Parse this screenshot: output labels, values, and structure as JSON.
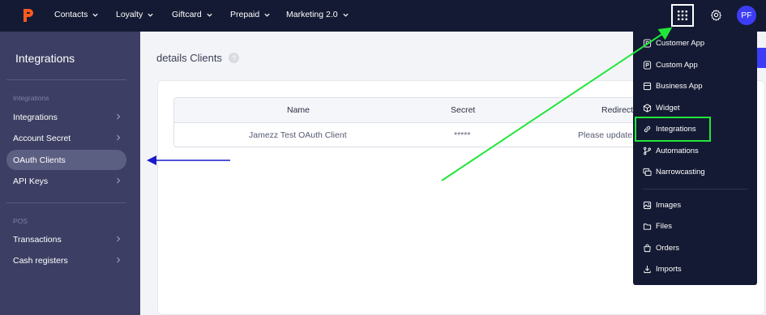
{
  "nav": {
    "items": [
      {
        "label": "Contacts"
      },
      {
        "label": "Loyalty"
      },
      {
        "label": "Giftcard"
      },
      {
        "label": "Prepaid"
      },
      {
        "label": "Marketing 2.0"
      }
    ],
    "avatar_initials": "PF",
    "icons": [
      "apps-grid-icon",
      "gear-icon"
    ]
  },
  "sidebar": {
    "title": "Integrations",
    "sections": [
      {
        "header": "Integrations",
        "items": [
          {
            "label": "Integrations",
            "active": false
          },
          {
            "label": "Account Secret",
            "active": false
          },
          {
            "label": "OAuth Clients",
            "active": true
          },
          {
            "label": "API Keys",
            "active": false
          }
        ]
      },
      {
        "header": "POS",
        "items": [
          {
            "label": "Transactions",
            "active": false
          },
          {
            "label": "Cash registers",
            "active": false
          }
        ]
      }
    ]
  },
  "main": {
    "title": "details Clients",
    "help_icon_label": "?",
    "table": {
      "columns": [
        "Name",
        "Secret",
        "Redirect"
      ],
      "rows": [
        {
          "name": "Jamezz Test OAuth Client",
          "secret": "*****",
          "redirect": "Please update"
        }
      ]
    }
  },
  "dropdown": {
    "groups": [
      [
        "Customer App",
        "Custom App",
        "Business App",
        "Widget",
        "Integrations",
        "Automations",
        "Narrowcasting"
      ],
      [
        "Images",
        "Files",
        "Orders",
        "Imports"
      ]
    ],
    "highlighted": "Integrations"
  },
  "colors": {
    "nav_bg": "#141a33",
    "sidebar_bg": "#3c3f63",
    "accent": "#3d3df5",
    "highlight": "#22e63a",
    "annotation_arrow": "#1a1acc"
  }
}
